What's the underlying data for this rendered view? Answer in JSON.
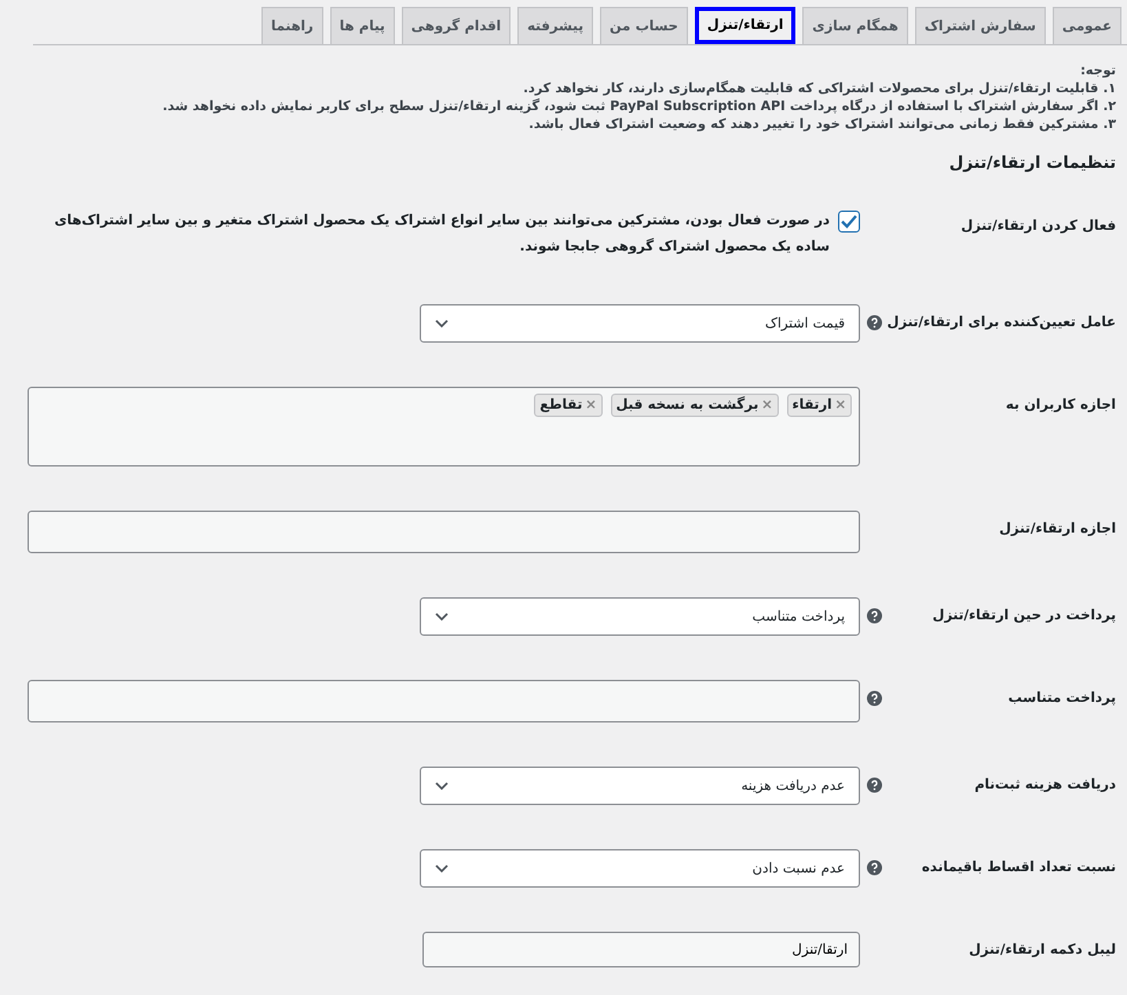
{
  "tabs": [
    {
      "label": "عمومی",
      "selected": false
    },
    {
      "label": "سفارش اشتراک",
      "selected": false
    },
    {
      "label": "همگام سازی",
      "selected": false
    },
    {
      "label": "ارتقاء/تنزل",
      "selected": true
    },
    {
      "label": "حساب من",
      "selected": false
    },
    {
      "label": "پیشرفته",
      "selected": false
    },
    {
      "label": "اقدام گروهی",
      "selected": false
    },
    {
      "label": "پیام ها",
      "selected": false
    },
    {
      "label": "راهنما",
      "selected": false
    }
  ],
  "notice": {
    "title": "توجه:",
    "lines": [
      "۱. قابلیت ارتقاء/تنزل برای محصولات اشتراکی که قابلیت همگام‌سازی دارند، کار نخواهد کرد.",
      "۲. اگر سفارش اشتراک با استفاده از درگاه پرداخت PayPal Subscription API ثبت شود، گزینه ارتقاء/تنزل سطح برای کاربر نمایش داده نخواهد شد.",
      "۳. مشترکین فقط زمانی می‌توانند اشتراک خود را تغییر دهند که وضعیت اشتراک فعال باشد."
    ]
  },
  "section_title": "تنظیمات ارتقاء/تنزل",
  "settings": [
    {
      "kind": "checkbox",
      "label": "فعال کردن ارتقاء/تنزل",
      "help": false,
      "checked": true,
      "description": "در صورت فعال بودن، مشترکین می‌توانند بین سایر انواع اشتراک یک محصول اشتراک متغیر و بین سایر اشتراک‌های ساده یک محصول اشتراک گروهی جابجا شوند."
    },
    {
      "kind": "select",
      "label": "عامل تعیین‌کننده برای ارتقاء/تنزل",
      "help": true,
      "value": "قیمت اشتراک"
    },
    {
      "kind": "tags",
      "label": "اجازه کاربران به",
      "help": false,
      "tags": [
        {
          "remove": "×",
          "text": "ارتقاء"
        },
        {
          "remove": "×",
          "text": "برگشت به نسخه قبل"
        },
        {
          "remove": "×",
          "text": "تقاطع"
        }
      ]
    },
    {
      "kind": "field",
      "label": "اجازه ارتقاء/تنزل",
      "help": false
    },
    {
      "kind": "select",
      "label": "پرداخت در حین ارتقاء/تنزل",
      "help": true,
      "value": "پرداخت متناسب"
    },
    {
      "kind": "field",
      "label": "پرداخت متناسب",
      "help": true
    },
    {
      "kind": "select",
      "label": "دریافت هزینه ثبت‌نام",
      "help": true,
      "value": "عدم دریافت هزینه"
    },
    {
      "kind": "select",
      "label": "نسبت تعداد اقساط باقیمانده",
      "help": true,
      "value": "عدم نسبت دادن"
    },
    {
      "kind": "text",
      "label": "لیبل دکمه ارتقاء/تنزل",
      "help": false,
      "value": "ارتقا/تنزل"
    }
  ]
}
